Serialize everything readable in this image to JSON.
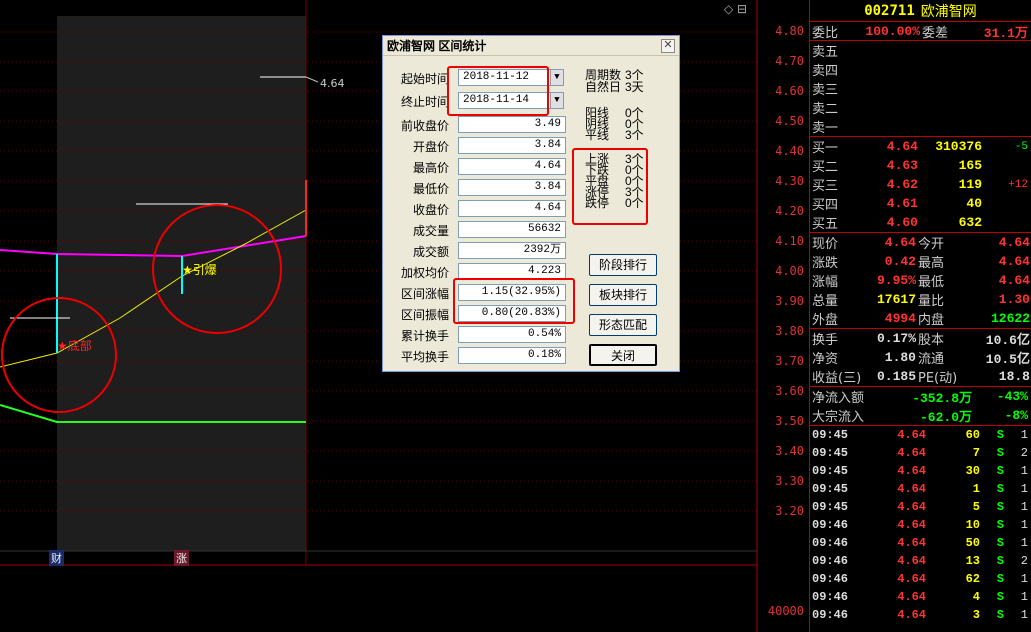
{
  "chart": {
    "price_axis": [
      "4.80",
      "4.70",
      "4.60",
      "4.50",
      "4.40",
      "4.30",
      "4.20",
      "4.10",
      "4.00",
      "3.90",
      "3.80",
      "3.70",
      "3.60",
      "3.50",
      "3.40",
      "3.30",
      "3.20"
    ],
    "volume_axis": "40000",
    "hline_label": "4.64",
    "marker_bottom": "底部",
    "marker_breakout": "引爆",
    "tag_fin": "财",
    "tag_up": "涨",
    "top_icons": "◇ ⊟"
  },
  "quote": {
    "code": "002711",
    "name": "欧浦智网",
    "weibi_label": "委比",
    "weibi": "100.00%",
    "weicha_label": "委差",
    "weicha": "31.1万",
    "asks": [
      {
        "label": "卖五"
      },
      {
        "label": "卖四"
      },
      {
        "label": "卖三"
      },
      {
        "label": "卖二"
      },
      {
        "label": "卖一"
      }
    ],
    "bids": [
      {
        "label": "买一",
        "price": "4.64",
        "vol": "310376",
        "chg": "-5"
      },
      {
        "label": "买二",
        "price": "4.63",
        "vol": "165",
        "chg": ""
      },
      {
        "label": "买三",
        "price": "4.62",
        "vol": "119",
        "chg": "+12"
      },
      {
        "label": "买四",
        "price": "4.61",
        "vol": "40",
        "chg": ""
      },
      {
        "label": "买五",
        "price": "4.60",
        "vol": "632",
        "chg": ""
      }
    ],
    "stats": [
      {
        "l1": "现价",
        "v1": "4.64",
        "l2": "今开",
        "v2": "4.64"
      },
      {
        "l1": "涨跌",
        "v1": "0.42",
        "l2": "最高",
        "v2": "4.64"
      },
      {
        "l1": "涨幅",
        "v1": "9.95%",
        "l2": "最低",
        "v2": "4.64"
      },
      {
        "l1": "总量",
        "v1": "17617",
        "l2": "量比",
        "v2": "1.30"
      },
      {
        "l1": "外盘",
        "v1": "4994",
        "l2": "内盘",
        "v2": "12622"
      }
    ],
    "stats2": [
      {
        "l1": "换手",
        "v1": "0.17%",
        "l2": "股本",
        "v2": "10.6亿"
      },
      {
        "l1": "净资",
        "v1": "1.80",
        "l2": "流通",
        "v2": "10.5亿"
      },
      {
        "l1": "收益(三)",
        "v1": "0.185",
        "l2": "PE(动)",
        "v2": "18.8"
      }
    ],
    "flows": [
      {
        "label": "净流入额",
        "v": "-352.8万",
        "p": "-43%"
      },
      {
        "label": "大宗流入",
        "v": "-62.0万",
        "p": "-8%"
      }
    ],
    "ticks": [
      {
        "t": "09:45",
        "p": "4.64",
        "v": "60",
        "s": "S",
        "n": "1"
      },
      {
        "t": "09:45",
        "p": "4.64",
        "v": "7",
        "s": "S",
        "n": "2"
      },
      {
        "t": "09:45",
        "p": "4.64",
        "v": "30",
        "s": "S",
        "n": "1"
      },
      {
        "t": "09:45",
        "p": "4.64",
        "v": "1",
        "s": "S",
        "n": "1"
      },
      {
        "t": "09:45",
        "p": "4.64",
        "v": "5",
        "s": "S",
        "n": "1"
      },
      {
        "t": "09:46",
        "p": "4.64",
        "v": "10",
        "s": "S",
        "n": "1"
      },
      {
        "t": "09:46",
        "p": "4.64",
        "v": "50",
        "s": "S",
        "n": "1"
      },
      {
        "t": "09:46",
        "p": "4.64",
        "v": "13",
        "s": "S",
        "n": "2"
      },
      {
        "t": "09:46",
        "p": "4.64",
        "v": "62",
        "s": "S",
        "n": "1"
      },
      {
        "t": "09:46",
        "p": "4.64",
        "v": "4",
        "s": "S",
        "n": "1"
      },
      {
        "t": "09:46",
        "p": "4.64",
        "v": "3",
        "s": "S",
        "n": "1"
      }
    ]
  },
  "dialog": {
    "title": "欧浦智网 区间统计",
    "start_label": "起始时间",
    "start": "2018-11-12",
    "end_label": "终止时间",
    "end": "2018-11-14",
    "fields": [
      {
        "label": "前收盘价",
        "value": "3.49"
      },
      {
        "label": "开盘价",
        "value": "3.84"
      },
      {
        "label": "最高价",
        "value": "4.64"
      },
      {
        "label": "最低价",
        "value": "3.84"
      },
      {
        "label": "收盘价",
        "value": "4.64"
      },
      {
        "label": "成交量",
        "value": "56632"
      },
      {
        "label": "成交额",
        "value": "2392万"
      },
      {
        "label": "加权均价",
        "value": "4.223"
      },
      {
        "label": "区间涨幅",
        "value": "1.15(32.95%)"
      },
      {
        "label": "区间振幅",
        "value": "0.80(20.83%)"
      },
      {
        "label": "累计换手",
        "value": "0.54%"
      },
      {
        "label": "平均换手",
        "value": "0.18%"
      }
    ],
    "period": [
      {
        "label": "周期数",
        "value": "3个"
      },
      {
        "label": "自然日",
        "value": "3天"
      }
    ],
    "candles": [
      {
        "label": "阳线",
        "value": "0个"
      },
      {
        "label": "阴线",
        "value": "0个"
      },
      {
        "label": "平线",
        "value": "3个"
      }
    ],
    "moves": [
      {
        "label": "上涨",
        "value": "3个"
      },
      {
        "label": "下跌",
        "value": "0个"
      },
      {
        "label": "平盘",
        "value": "0个"
      },
      {
        "label": "涨停",
        "value": "3个"
      },
      {
        "label": "跌停",
        "value": "0个"
      }
    ],
    "buttons": {
      "stage": "阶段排行",
      "sector": "板块排行",
      "pattern": "形态匹配",
      "close": "关闭"
    }
  }
}
